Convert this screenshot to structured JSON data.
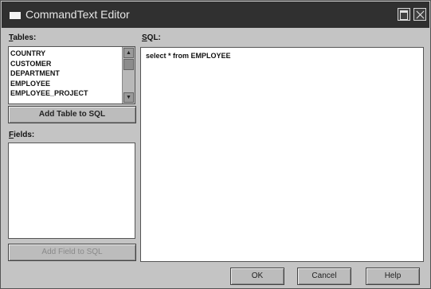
{
  "window": {
    "title": "CommandText Editor"
  },
  "tables": {
    "label_accel": "T",
    "label_rest": "ables:",
    "items": [
      "COUNTRY",
      "CUSTOMER",
      "DEPARTMENT",
      "EMPLOYEE",
      "EMPLOYEE_PROJECT"
    ],
    "add_button": "Add Table to SQL"
  },
  "fields": {
    "label_accel": "F",
    "label_rest": "ields:",
    "add_button": "Add Field to SQL"
  },
  "sql": {
    "label_accel": "S",
    "label_rest": "QL:",
    "text": "select * from EMPLOYEE"
  },
  "buttons": {
    "ok": "OK",
    "cancel": "Cancel",
    "help": "Help"
  }
}
